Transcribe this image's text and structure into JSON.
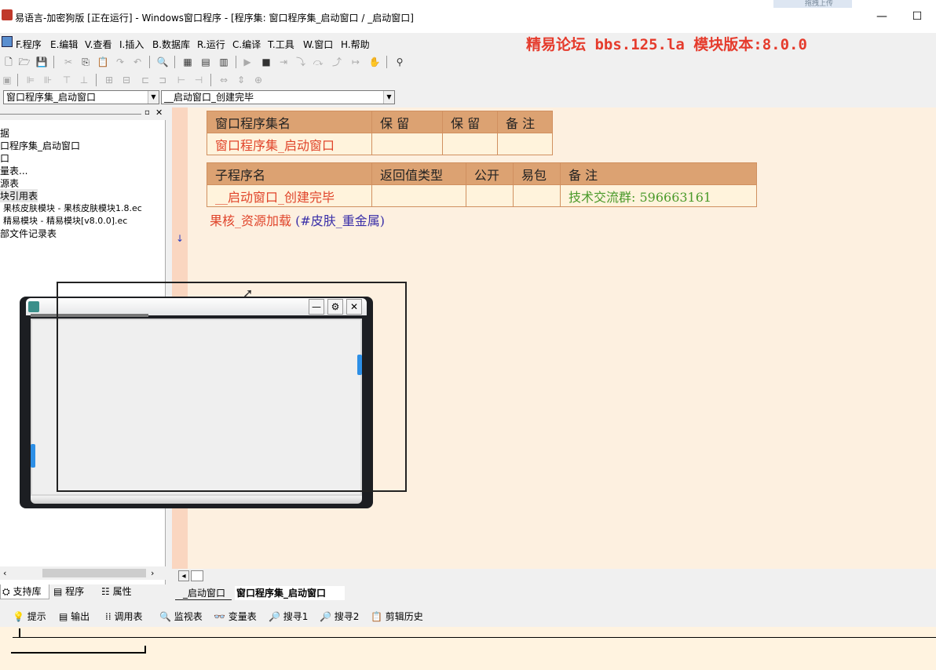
{
  "window": {
    "title": "易语言-加密狗版 [正在运行] - Windows窗口程序 - [程序集: 窗口程序集_启动窗口 / _启动窗口]",
    "upload_badge": "拖拽上传",
    "minimize_glyph": "—",
    "maximize_glyph": "☐"
  },
  "menu": {
    "items": [
      "F.程序",
      "E.编辑",
      "V.查看",
      "I.插入",
      "B.数据库",
      "R.运行",
      "C.编译",
      "T.工具",
      "W.窗口",
      "H.帮助"
    ],
    "banner": "精易论坛 bbs.125.la 模块版本:8.0.0"
  },
  "combos": {
    "class_selector": "窗口程序集_启动窗口",
    "sub_selector": "__启动窗口_创建完毕"
  },
  "left_panel": {
    "tree": [
      "据",
      "口程序集_启动窗口",
      "口",
      "量表...",
      "源表",
      "块引用表",
      "果核皮肤模块 - 果核皮肤模块1.8.ec",
      "精易模块 - 精易模块[v8.0.0].ec",
      "部文件记录表"
    ],
    "tabs": [
      "支持库",
      "程序",
      "属性"
    ]
  },
  "editor": {
    "class_table": {
      "headers": [
        "窗口程序集名",
        "保 留",
        "保 留",
        "备 注"
      ],
      "row": [
        "窗口程序集_启动窗口",
        "",
        "",
        ""
      ]
    },
    "sub_table": {
      "headers": [
        "子程序名",
        "返回值类型",
        "公开",
        "易包",
        "备 注"
      ],
      "row": [
        "__启动窗口_创建完毕",
        "",
        "",
        "",
        "技术交流群:   596663161"
      ]
    },
    "code_line_call": "果核_资源加载",
    "code_line_args": " (#皮肤_重金属)",
    "gutter_arrow": "↓"
  },
  "file_tabs": [
    "_启动窗口",
    "窗口程序集_启动窗口"
  ],
  "bottom_tabs": [
    "提示",
    "输出",
    "调用表",
    "监视表",
    "变量表",
    "搜寻1",
    "搜寻2",
    "剪辑历史"
  ],
  "colors": {
    "banner": "#e53b2c",
    "header_cell": "#dca272",
    "code_red": "#e0442a",
    "code_green": "#4a9a2a"
  }
}
